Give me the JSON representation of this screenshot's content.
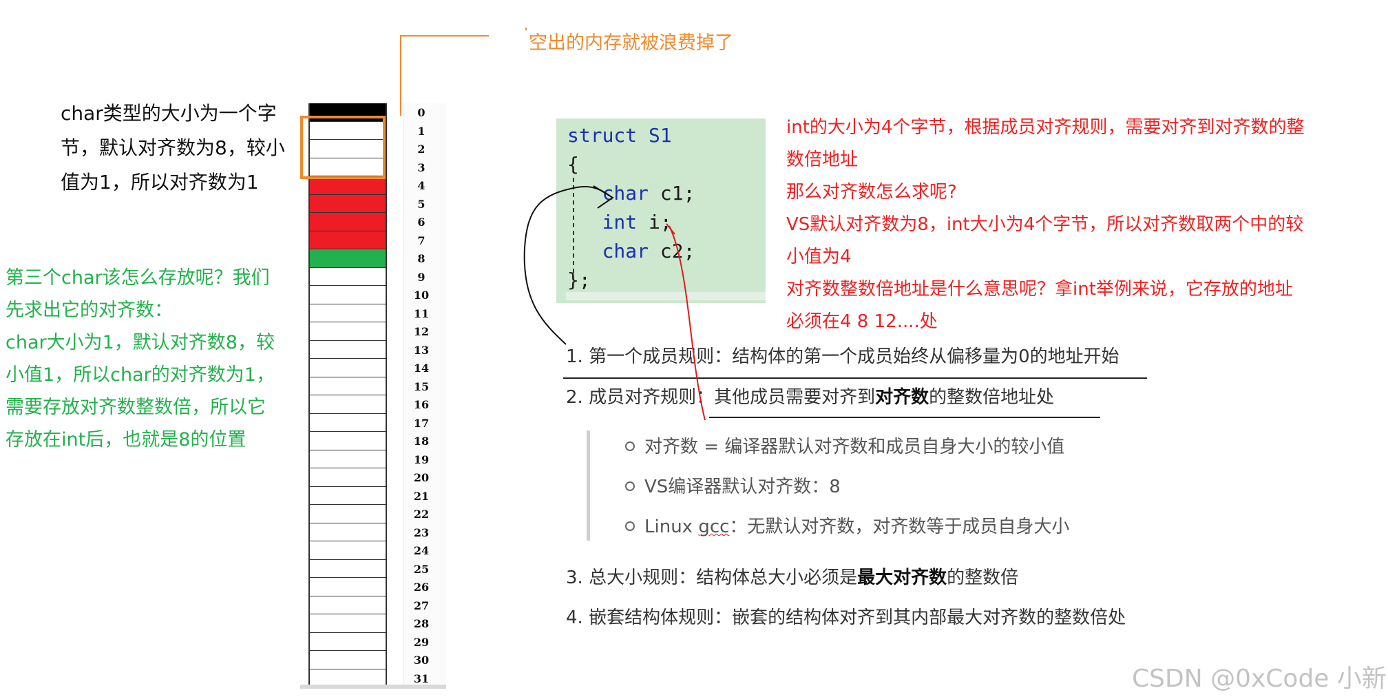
{
  "notes": {
    "char_note": [
      "char类型的大小为一个字",
      "节，默认对齐数为8，较小",
      "值为1，所以对齐数为1"
    ],
    "third_char_note": [
      "第三个char该怎么存放呢？我们",
      "先求出它的对齐数：",
      "char大小为1，默认对齐数8，较",
      "小值1，所以char的对齐数为1，",
      "需要存放对齐数整数倍，所以它",
      "存放在int后，也就是8的位置"
    ],
    "wasted_caption": "空出的内存就被浪费掉了"
  },
  "memory": {
    "indices": [
      "0",
      "1",
      "2",
      "3",
      "4",
      "5",
      "6",
      "7",
      "8",
      "9",
      "10",
      "11",
      "12",
      "13",
      "14",
      "15",
      "16",
      "17",
      "18",
      "19",
      "20",
      "21",
      "22",
      "23",
      "24",
      "25",
      "26",
      "27",
      "28",
      "29",
      "30",
      "31"
    ],
    "filled": [
      {
        "index": 0,
        "color": "#000000"
      },
      {
        "index": 4,
        "color": "#ee1c24"
      },
      {
        "index": 5,
        "color": "#ee1c24"
      },
      {
        "index": 6,
        "color": "#ee1c24"
      },
      {
        "index": 7,
        "color": "#ee1c24"
      },
      {
        "index": 8,
        "color": "#22b14c"
      }
    ]
  },
  "code": {
    "l1_kw": "struct",
    "l1_rest": " S1",
    "l2": "{",
    "l3_kw": "char",
    "l3_rest": " c1;",
    "l4_kw": "int",
    "l4_rest": " i;",
    "l5_kw": "char",
    "l5_rest": " c2;",
    "l6": "};"
  },
  "explanation": [
    "int的大小为4个字节，根据成员对齐规则，需要对齐到对齐数的整",
    "数倍地址",
    "那么对齐数怎么求呢?",
    "VS默认对齐数为8，int大小为4个字节，所以对齐数取两个中的较",
    "小值为4",
    "对齐数整数倍地址是什么意思呢？拿int举例来说，它存放的地址",
    "必须在4 8 12....处"
  ],
  "rules": {
    "r1": "1. 第一个成员规则：结构体的第一个成员始终从偏移量为0的地址开始",
    "r2_pre": "2. 成员对齐规则：其他成员需要对齐到",
    "r2_bold": "对齐数",
    "r2_post": "的整数倍地址处",
    "s1": "对齐数 = 编译器默认对齐数和成员自身大小的较小值",
    "s2": "VS编译器默认对齐数：8",
    "s3_pre": "Linux ",
    "s3_wavy": "gcc",
    "s3_post": "：无默认对齐数，对齐数等于成员自身大小",
    "r3_pre": "3. 总大小规则：结构体总大小必须是",
    "r3_bold": "最大对齐数",
    "r3_post": "的整数倍",
    "r4": "4. 嵌套结构体规则：嵌套的结构体对齐到其内部最大对齐数的整数倍处"
  },
  "watermark": "CSDN @0xCode 小新",
  "colors": {
    "orange": "#f08a2c",
    "red_text": "#ee2222",
    "green_text": "#22b24c",
    "code_bg": "#cde8cf",
    "keyword": "#1c2fb0"
  }
}
